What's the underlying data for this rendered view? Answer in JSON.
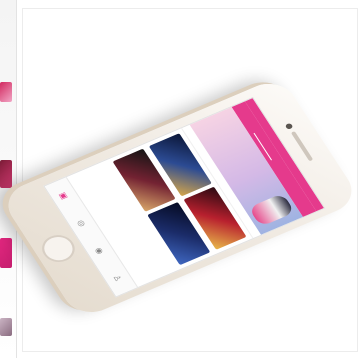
{
  "colors": {
    "accent": "#e53a8c",
    "phone_body": "#f0eae2",
    "screen_bg": "#ffffff"
  },
  "phone": {
    "status": {
      "left": "",
      "right": ""
    },
    "tabs": [
      {
        "label": "",
        "active": false
      },
      {
        "label": "",
        "active": true
      },
      {
        "label": "",
        "active": false
      },
      {
        "label": "",
        "active": false
      }
    ],
    "banner": {
      "title": "",
      "subtitle": ""
    },
    "section_title": "",
    "cards": [
      {
        "caption": ""
      },
      {
        "caption": ""
      },
      {
        "caption": ""
      },
      {
        "caption": ""
      }
    ],
    "bottom_nav": [
      {
        "icon": "home-icon",
        "glyph": "▣",
        "label": ""
      },
      {
        "icon": "discover-icon",
        "glyph": "◎",
        "label": ""
      },
      {
        "icon": "chat-icon",
        "glyph": "◉",
        "label": ""
      },
      {
        "icon": "profile-icon",
        "glyph": "♙",
        "label": ""
      }
    ]
  }
}
